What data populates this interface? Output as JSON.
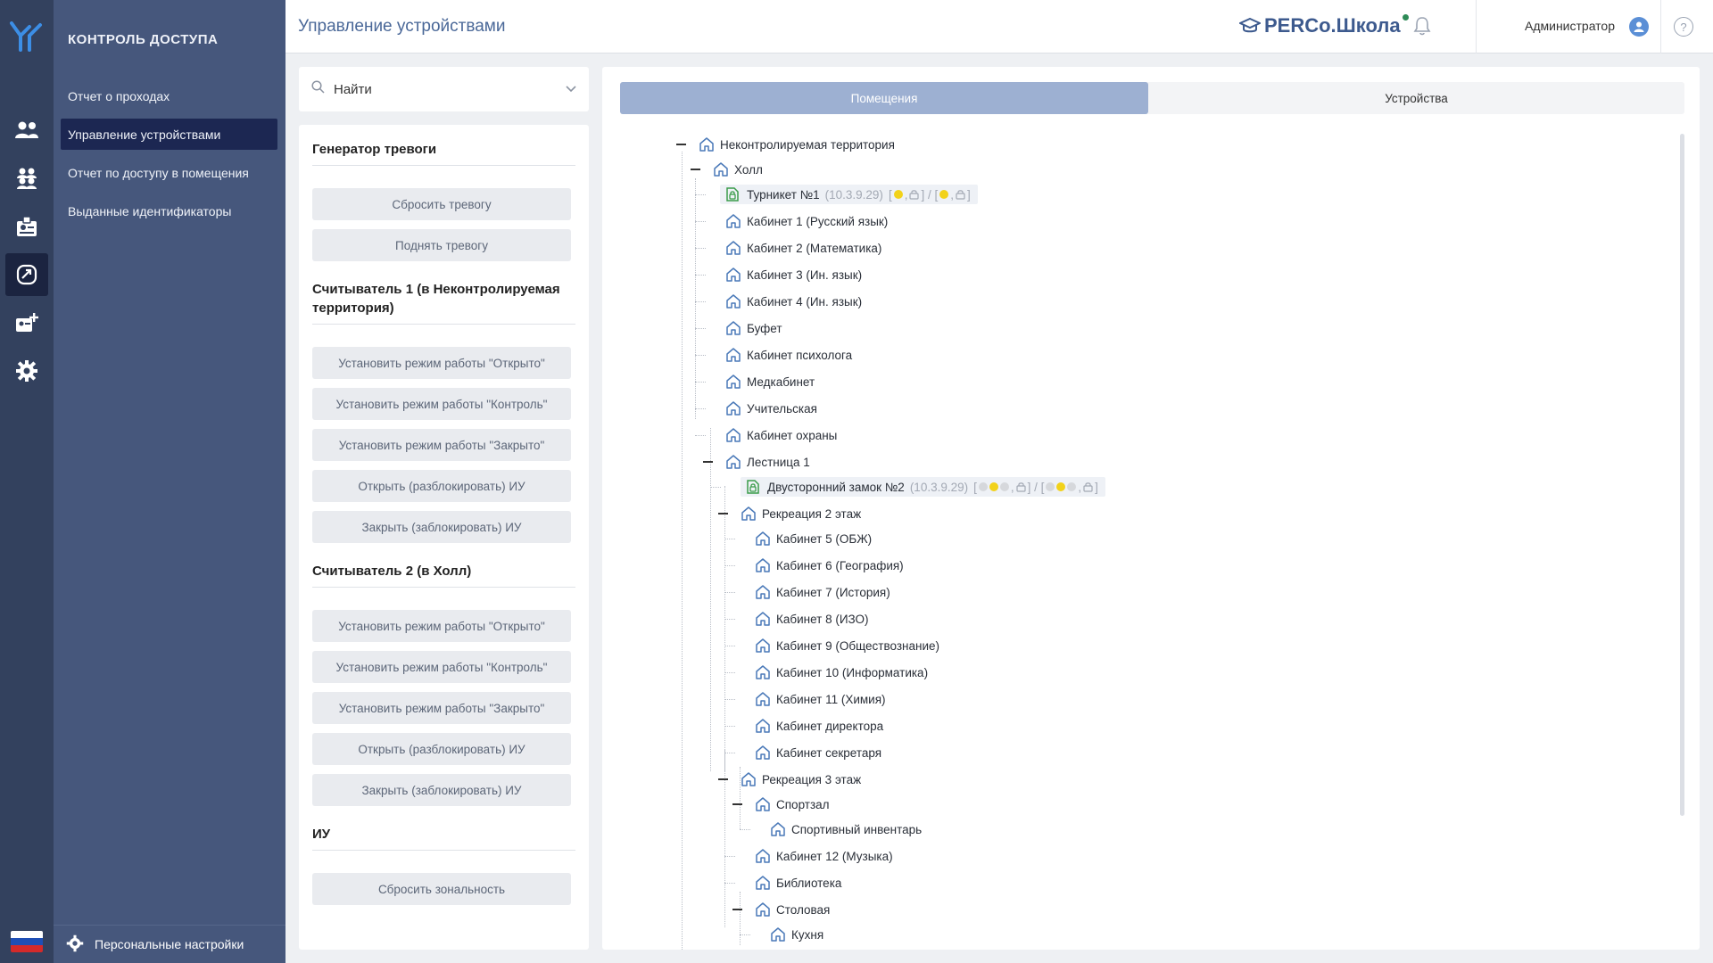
{
  "rail": {
    "icons": [
      "logo-icon",
      "people-icon",
      "groups-icon",
      "badge-icon",
      "devices-icon",
      "add-card-icon",
      "gear-icon"
    ],
    "flag_colors": [
      "#ffffff",
      "#1f4fb5",
      "#d42a2a"
    ]
  },
  "nav": {
    "section_title": "КОНТРОЛЬ ДОСТУПА",
    "items": [
      {
        "label": "Отчет о проходах",
        "active": false
      },
      {
        "label": "Управление устройствами",
        "active": true
      },
      {
        "label": "Отчет по доступу в помещения",
        "active": false
      },
      {
        "label": "Выданные идентификаторы",
        "active": false
      }
    ],
    "footer_label": "Персональные настройки"
  },
  "header": {
    "title": "Управление устройствами",
    "brand": "PERCo.Школа",
    "user": "Администратор",
    "help": "?"
  },
  "search": {
    "placeholder": "Найти"
  },
  "controls": {
    "alarm": {
      "title": "Генератор тревоги",
      "buttons": [
        "Сбросить тревогу",
        "Поднять тревогу"
      ]
    },
    "reader1": {
      "title": "Считыватель 1 (в Неконтролируемая территория)",
      "buttons": [
        "Установить режим работы \"Открыто\"",
        "Установить режим работы \"Контроль\"",
        "Установить режим работы \"Закрыто\"",
        "Открыть (разблокировать) ИУ",
        "Закрыть (заблокировать) ИУ"
      ]
    },
    "reader2": {
      "title": "Считыватель 2 (в Холл)",
      "buttons": [
        "Установить режим работы \"Открыто\"",
        "Установить режим работы \"Контроль\"",
        "Установить режим работы \"Закрыто\"",
        "Открыть (разблокировать) ИУ",
        "Закрыть (заблокировать) ИУ"
      ]
    },
    "iu": {
      "title": "ИУ",
      "buttons": [
        "Сбросить зональность"
      ]
    }
  },
  "tabs": [
    "Помещения",
    "Устройства"
  ],
  "tree": {
    "root": "Неконтролируемая территория",
    "hall": "Холл",
    "turnstile": {
      "name": "Турникет №1",
      "ip": "(10.3.9.29)",
      "open1": "[",
      "sep1": ",",
      "close_open": "] / [",
      "sep2": ",",
      "close": "]"
    },
    "hall_rooms": [
      "Кабинет 1 (Русский язык)",
      "Кабинет 2 (Математика)",
      "Кабинет 3 (Ин. язык)",
      "Кабинет 4 (Ин. язык)",
      "Буфет",
      "Кабинет психолога",
      "Медкабинет",
      "Учительская",
      "Кабинет охраны"
    ],
    "stairs": "Лестница 1",
    "lock2": {
      "name": "Двусторонний замок №2",
      "ip": "(10.3.9.29)",
      "open1": "[",
      "sep1": ",",
      "close_open": "] / [",
      "sep2": ",",
      "close": "]"
    },
    "rec2": "Рекреация 2 этаж",
    "rec2_rooms": [
      "Кабинет 5 (ОБЖ)",
      "Кабинет 6 (География)",
      "Кабинет 7 (История)",
      "Кабинет 8 (ИЗО)",
      "Кабинет 9 (Обществознание)",
      "Кабинет 10 (Информатика)",
      "Кабинет 11 (Химия)",
      "Кабинет директора",
      "Кабинет секретаря"
    ],
    "rec3": "Рекреация 3 этаж",
    "gym": "Спортзал",
    "gym_inventory": "Спортивный инвентарь",
    "music": "Кабинет 12 (Музыка)",
    "library": "Библиотека",
    "canteen": "Столовая",
    "kitchen": "Кухня"
  }
}
